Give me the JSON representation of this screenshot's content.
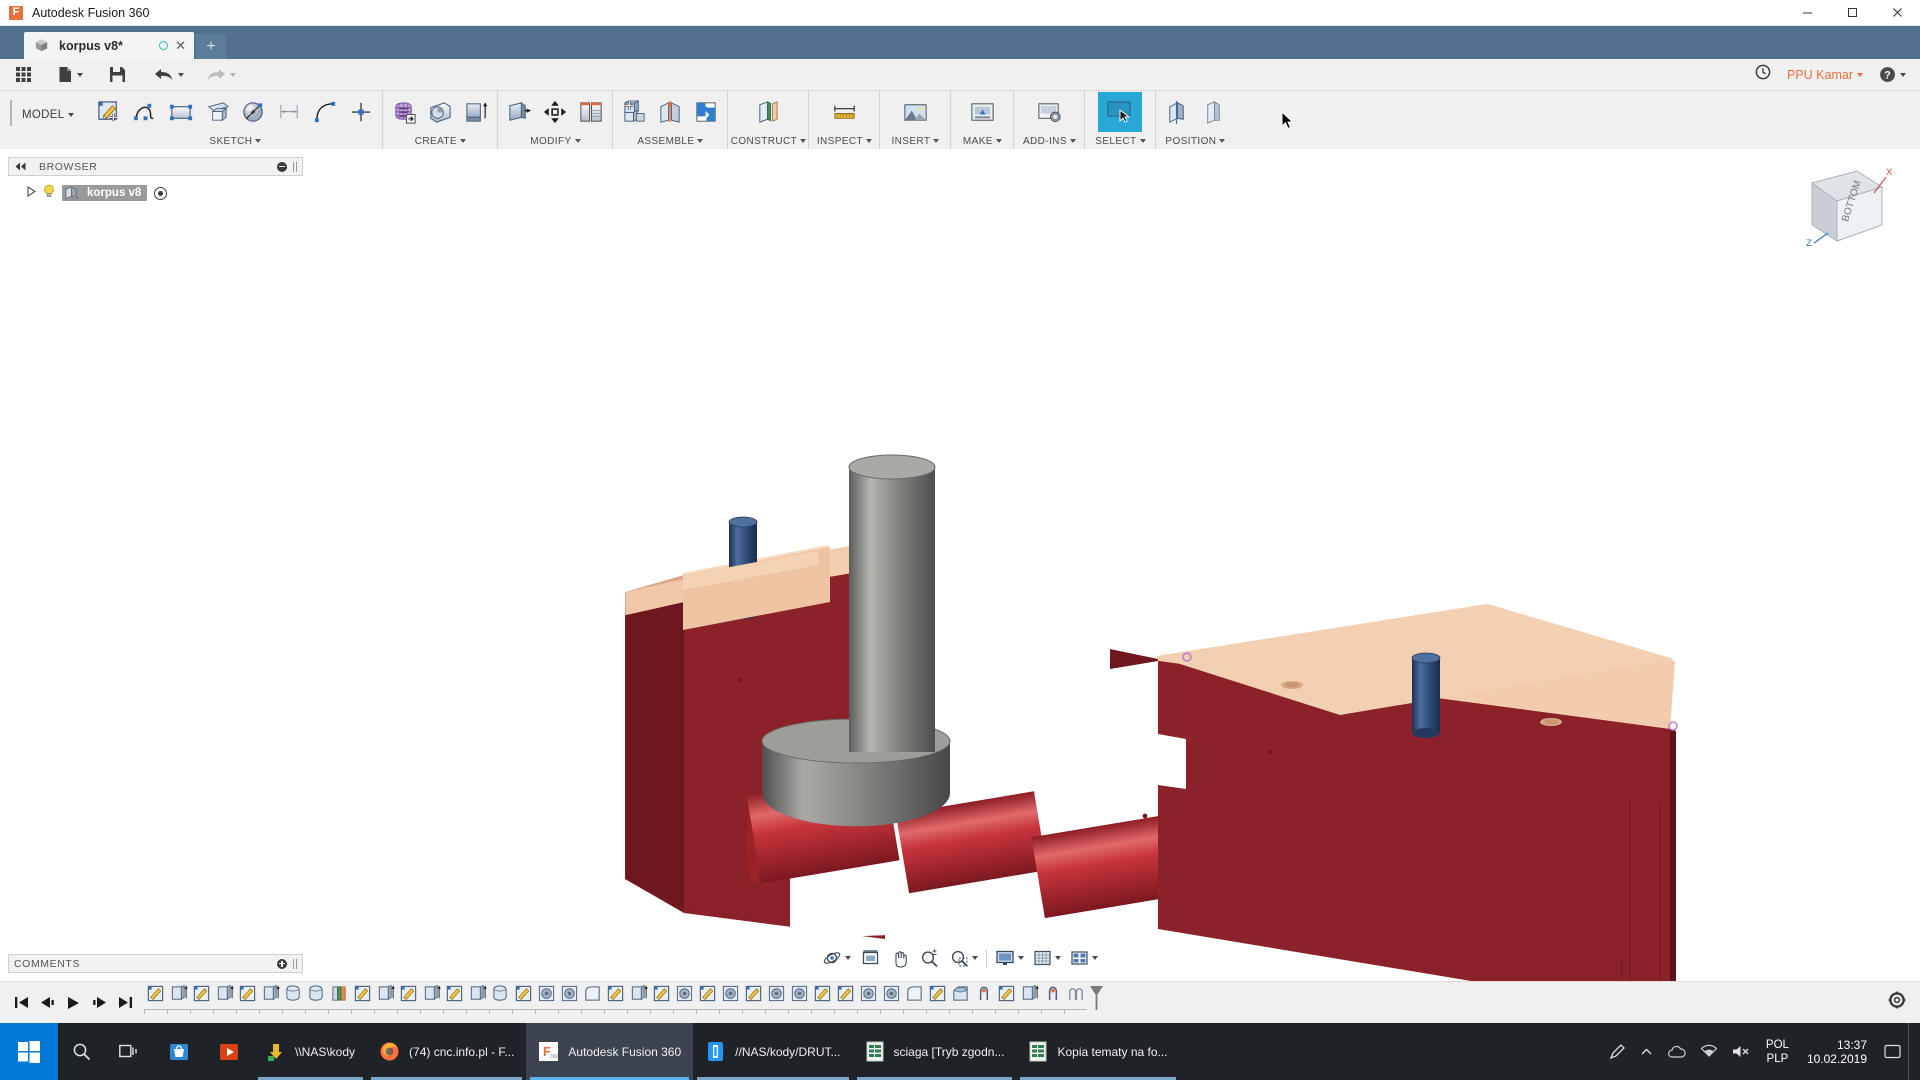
{
  "window": {
    "title": "Autodesk Fusion 360",
    "app_logo_letter": "F",
    "minimize_icon": "minimize-icon",
    "maximize_icon": "maximize-icon",
    "close_icon": "close-icon"
  },
  "tabs": {
    "items": [
      {
        "label": "korpus v8*",
        "icon": "component-cube-icon",
        "modified_indicator": "unsaved-dot",
        "close_icon": "close-icon"
      }
    ],
    "new_tab_label": "+"
  },
  "quick_access": {
    "items": [
      {
        "name": "app-grid-button",
        "icon": "grid-9-icon"
      },
      {
        "name": "new-file-button",
        "icon": "file-icon",
        "has_caret": true
      },
      {
        "name": "save-button",
        "icon": "floppy-save-icon"
      },
      {
        "name": "undo-button",
        "icon": "undo-arrow-icon",
        "has_caret": true
      },
      {
        "name": "redo-button",
        "icon": "redo-arrow-icon",
        "has_caret": true
      }
    ],
    "right": {
      "history_icon": "clock-history-icon",
      "account_name": "PPU Kamar",
      "help_icon": "help-question-icon"
    },
    "accent_color": "#e8703a"
  },
  "ribbon": {
    "workspace": "MODEL",
    "selected_button": "select-tool",
    "panels": [
      {
        "label": "SKETCH",
        "buttons": [
          {
            "name": "create-sketch-button",
            "icon": "sketch-pencil-icon"
          },
          {
            "name": "spline-button",
            "icon": "spline-curve-icon"
          },
          {
            "name": "rectangle-button",
            "icon": "rectangle-icon"
          },
          {
            "name": "offset-plane-sketch-button",
            "icon": "plane-cube-icon"
          },
          {
            "name": "circle-button",
            "icon": "circle-diameter-icon"
          },
          {
            "name": "dimension-button",
            "icon": "linear-dimension-icon"
          },
          {
            "name": "arc-button",
            "icon": "arc-icon"
          },
          {
            "name": "point-button",
            "icon": "point-crosshair-icon"
          }
        ]
      },
      {
        "label": "CREATE",
        "buttons": [
          {
            "name": "create-form-button",
            "icon": "purple-mesh-box-icon"
          },
          {
            "name": "revolve-button",
            "icon": "revolve-icon"
          },
          {
            "name": "extrude-button",
            "icon": "extrude-arrow-icon"
          }
        ]
      },
      {
        "label": "MODIFY",
        "buttons": [
          {
            "name": "press-pull-button",
            "icon": "press-pull-icon"
          },
          {
            "name": "move-copy-button",
            "icon": "move-four-arrows-icon"
          },
          {
            "name": "change-parameters-button",
            "icon": "parameters-table-icon"
          }
        ]
      },
      {
        "label": "ASSEMBLE",
        "buttons": [
          {
            "name": "new-component-button",
            "icon": "new-component-plus-icon"
          },
          {
            "name": "joint-button",
            "icon": "joint-hinge-icon"
          },
          {
            "name": "as-built-joint-button",
            "icon": "puzzle-pieces-icon"
          }
        ]
      },
      {
        "label": "CONSTRUCT",
        "buttons": [
          {
            "name": "offset-plane-button",
            "icon": "offset-plane-icon"
          }
        ]
      },
      {
        "label": "INSPECT",
        "buttons": [
          {
            "name": "measure-button",
            "icon": "ruler-measure-icon"
          }
        ]
      },
      {
        "label": "INSERT",
        "buttons": [
          {
            "name": "insert-canvas-button",
            "icon": "picture-landscape-icon"
          }
        ]
      },
      {
        "label": "MAKE",
        "buttons": [
          {
            "name": "3d-print-button",
            "icon": "3d-printer-icon"
          }
        ]
      },
      {
        "label": "ADD-INS",
        "buttons": [
          {
            "name": "scripts-addins-button",
            "icon": "gear-script-icon"
          }
        ]
      },
      {
        "label": "SELECT",
        "buttons": [
          {
            "name": "select-tool",
            "icon": "select-arrow-icon",
            "selected": true
          }
        ]
      },
      {
        "label": "POSITION",
        "buttons": [
          {
            "name": "align-button",
            "icon": "align-icon"
          },
          {
            "name": "position-button",
            "icon": "position-icon"
          }
        ]
      }
    ]
  },
  "browser": {
    "title": "BROWSER",
    "collapse_icon": "collapse-left-icon",
    "minimize_icon": "circle-minus-icon",
    "grip_icon": "panel-grip-icon",
    "tree": [
      {
        "label": "korpus v8",
        "expand_icon": "expand-triangle-icon",
        "visibility_icon": "lightbulb-icon",
        "type_icon": "component-icon",
        "selected": true,
        "target_icon": "origin-target-icon"
      }
    ]
  },
  "comments": {
    "title": "COMMENTS",
    "add_icon": "circle-plus-icon",
    "grip_icon": "panel-grip-icon"
  },
  "viewcube": {
    "face_label": "BOTTOM",
    "axis_x": "X",
    "axis_z": "Z"
  },
  "navbar": {
    "items": [
      {
        "name": "orbit-button",
        "icon": "orbit-icon",
        "has_caret": true
      },
      {
        "name": "look-at-button",
        "icon": "look-at-icon"
      },
      {
        "name": "pan-button",
        "icon": "pan-hand-icon"
      },
      {
        "name": "zoom-button",
        "icon": "zoom-plus-minus-icon"
      },
      {
        "name": "fit-button",
        "icon": "zoom-window-icon",
        "has_caret": true
      },
      {
        "name": "display-settings-button",
        "icon": "monitor-display-icon",
        "has_caret": true
      },
      {
        "name": "grid-snaps-button",
        "icon": "grid-snap-icon",
        "has_caret": true
      },
      {
        "name": "viewports-button",
        "icon": "viewports-icon",
        "has_caret": true
      }
    ]
  },
  "timeline": {
    "playback": [
      {
        "name": "go-to-beginning-button",
        "icon": "skip-back-icon"
      },
      {
        "name": "step-back-button",
        "icon": "step-back-icon"
      },
      {
        "name": "play-button",
        "icon": "play-icon"
      },
      {
        "name": "step-forward-button",
        "icon": "step-forward-icon"
      },
      {
        "name": "go-to-end-button",
        "icon": "skip-forward-icon"
      }
    ],
    "features": [
      "sketch",
      "extrude",
      "sketch",
      "extrude",
      "sketch",
      "extrude",
      "revolve",
      "revolve",
      "appearance",
      "sketch",
      "extrude",
      "sketch",
      "extrude",
      "sketch",
      "extrude",
      "revolve",
      "sketch",
      "hole",
      "hole",
      "fillet",
      "sketch",
      "extrude",
      "sketch",
      "hole",
      "sketch",
      "hole",
      "sketch",
      "hole",
      "hole",
      "sketch",
      "sketch",
      "hole",
      "hole",
      "fillet",
      "sketch",
      "chamfer",
      "joint",
      "sketch",
      "extrude",
      "joint",
      "joint-alt"
    ],
    "marker_icon": "timeline-end-marker",
    "settings_icon": "gear-icon"
  },
  "taskbar": {
    "start_icon": "windows-start-icon",
    "search_icon": "search-icon",
    "taskview_icon": "task-view-icon",
    "pinned": [
      {
        "name": "store-icon",
        "label": "Microsoft Store"
      },
      {
        "name": "media-player-icon",
        "label": "Media Player"
      }
    ],
    "items": [
      {
        "label": "\\\\NAS\\kody",
        "icon": "download-folder-icon",
        "active": false
      },
      {
        "label": "(74) cnc.info.pl - F...",
        "icon": "firefox-icon",
        "active": false
      },
      {
        "label": "Autodesk Fusion 360",
        "icon": "fusion-icon",
        "active": true
      },
      {
        "label": "//NAS/kody/DRUT...",
        "icon": "file-explorer-icon",
        "active": false
      },
      {
        "label": "sciaga  [Tryb zgodn...",
        "icon": "excel-icon",
        "active": false
      },
      {
        "label": "Kopia tematy na fo...",
        "icon": "excel-icon",
        "active": false
      }
    ],
    "tray": {
      "pen_icon": "pen-input-icon",
      "chevron_icon": "show-hidden-icons-icon",
      "onedrive_icon": "onedrive-icon",
      "network_icon": "network-icon",
      "volume_icon": "volume-mute-icon",
      "language_top": "POL",
      "language_bottom": "PLP",
      "time": "13:37",
      "date": "10.02.2019",
      "notifications_icon": "action-center-icon"
    }
  },
  "model": {
    "description": "3D CAD assembly: dark red body blocks with tan top faces, red cylindrical rollers, grey stepped shaft, blue pins",
    "colors": {
      "body_dark_red": "#8a2028",
      "body_top_tan": "#f2c9ab",
      "roller_red": "#c0303a",
      "shaft_grey": "#7d7d7d",
      "pin_blue": "#33507f"
    }
  }
}
